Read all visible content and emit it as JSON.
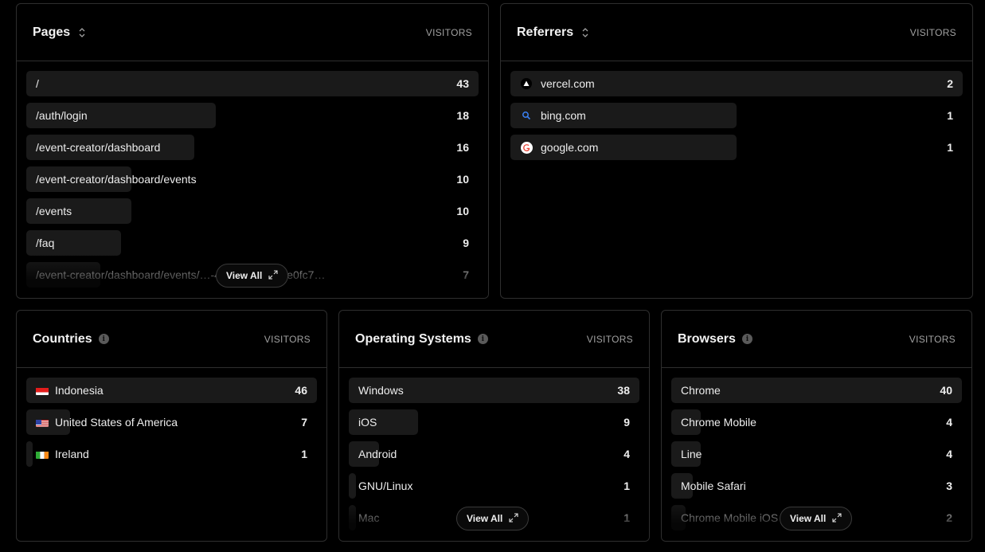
{
  "pages": {
    "title": "Pages",
    "visitors_label": "VISITORS",
    "view_all": "View All",
    "rows": [
      {
        "label": "/",
        "value": "43",
        "share": 1.0
      },
      {
        "label": "/auth/login",
        "value": "18",
        "share": 0.419
      },
      {
        "label": "/event-creator/dashboard",
        "value": "16",
        "share": 0.372
      },
      {
        "label": "/event-creator/dashboard/events",
        "value": "10",
        "share": 0.233
      },
      {
        "label": "/events",
        "value": "10",
        "share": 0.233
      },
      {
        "label": "/faq",
        "value": "9",
        "share": 0.209
      },
      {
        "label": "/event-creator/dashboard/events/…-4461-b05f-0a7e0fc7…",
        "value": "7",
        "share": 0.163
      }
    ]
  },
  "referrers": {
    "title": "Referrers",
    "visitors_label": "VISITORS",
    "rows": [
      {
        "label": "vercel.com",
        "value": "2",
        "share": 1.0,
        "icon": "vercel-icon"
      },
      {
        "label": "bing.com",
        "value": "1",
        "share": 0.5,
        "icon": "bing-search-icon"
      },
      {
        "label": "google.com",
        "value": "1",
        "share": 0.5,
        "icon": "google-icon"
      }
    ]
  },
  "countries": {
    "title": "Countries",
    "visitors_label": "VISITORS",
    "rows": [
      {
        "label": "Indonesia",
        "value": "46",
        "share": 1.0,
        "icon": "indonesia-flag-icon"
      },
      {
        "label": "United States of America",
        "value": "7",
        "share": 0.152,
        "icon": "usa-flag-icon"
      },
      {
        "label": "Ireland",
        "value": "1",
        "share": 0.022,
        "icon": "ireland-flag-icon"
      }
    ]
  },
  "os": {
    "title": "Operating Systems",
    "visitors_label": "VISITORS",
    "view_all": "View All",
    "rows": [
      {
        "label": "Windows",
        "value": "38",
        "share": 1.0
      },
      {
        "label": "iOS",
        "value": "9",
        "share": 0.237
      },
      {
        "label": "Android",
        "value": "4",
        "share": 0.105
      },
      {
        "label": "GNU/Linux",
        "value": "1",
        "share": 0.026
      },
      {
        "label": "Mac",
        "value": "1",
        "share": 0.026
      }
    ]
  },
  "browsers": {
    "title": "Browsers",
    "visitors_label": "VISITORS",
    "view_all": "View All",
    "rows": [
      {
        "label": "Chrome",
        "value": "40",
        "share": 1.0
      },
      {
        "label": "Chrome Mobile",
        "value": "4",
        "share": 0.1
      },
      {
        "label": "Line",
        "value": "4",
        "share": 0.1
      },
      {
        "label": "Mobile Safari",
        "value": "3",
        "share": 0.075
      },
      {
        "label": "Chrome Mobile iOS",
        "value": "2",
        "share": 0.05
      }
    ]
  },
  "colors": {
    "background": "#000000",
    "bar": "#1a1a1a",
    "border": "#2e2e2e",
    "muted_text": "#a1a1a1"
  }
}
